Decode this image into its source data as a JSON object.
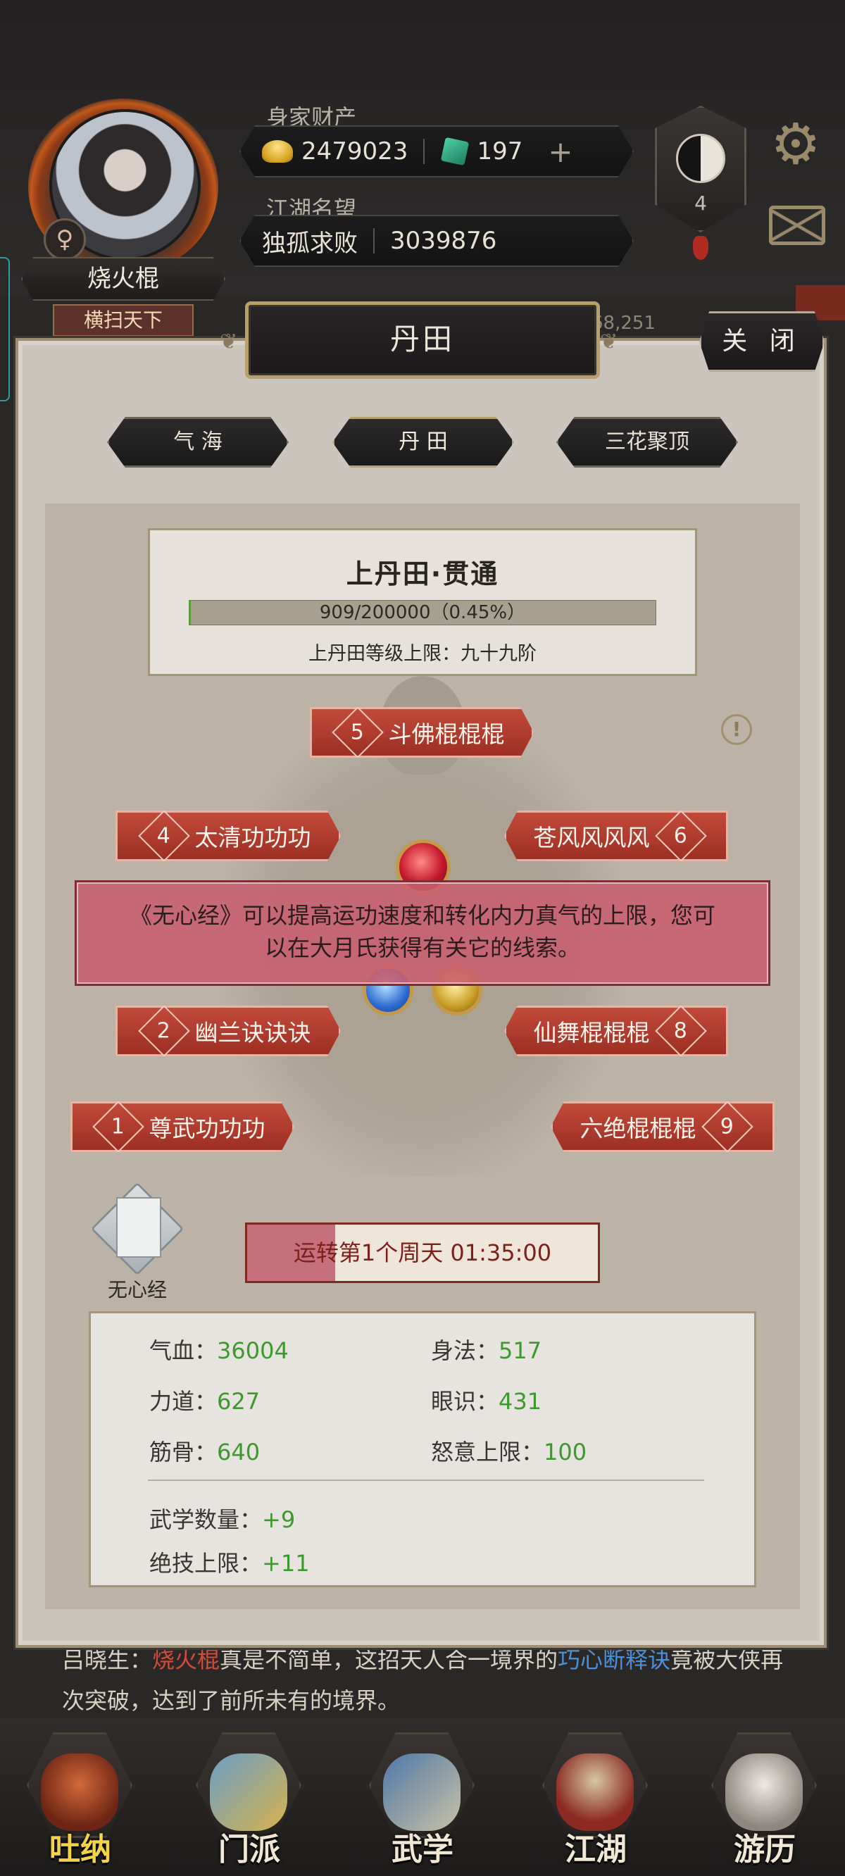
{
  "hud": {
    "player_name": "烧火棍",
    "player_title": "横扫天下",
    "gender_symbol": "♀",
    "wealth_label": "身家财产",
    "gold": "2479023",
    "jade": "197",
    "plus_symbol": "+",
    "reputation_label": "江湖名望",
    "reputation_rank": "独孤求败",
    "reputation_value": "3039876",
    "taiji_level": "4",
    "gear_glyph": "⚙",
    "background_counter": "68,251"
  },
  "dialog": {
    "title": "丹田",
    "close_label": "关 闭",
    "tabs": [
      "气 海",
      "丹 田",
      "三花聚顶"
    ],
    "active_tab": "丹 田",
    "status": {
      "title": "上丹田·贯通",
      "progress_text": "909/200000（0.45%）",
      "progress_fraction": 0.0045,
      "cap_text": "上丹田等级上限：九十九阶"
    },
    "alert_glyph": "!",
    "skills": [
      {
        "num": "5",
        "name": "斗佛棍棍棍"
      },
      {
        "num": "4",
        "name": "太清功功功"
      },
      {
        "num": "6",
        "name": "苍风风风风"
      },
      {
        "num": "2",
        "name": "幽兰诀诀诀"
      },
      {
        "num": "8",
        "name": "仙舞棍棍棍"
      },
      {
        "num": "1",
        "name": "尊武功功功"
      },
      {
        "num": "9",
        "name": "六绝棍棍棍"
      }
    ],
    "tooltip": "《无心经》可以提高运功速度和转化内力真气的上限，您可以在大月氏获得有关它的线索。",
    "book_label": "无心经",
    "cycle": {
      "text": "运转第1个周天 01:35:00",
      "progress_fraction": 0.25
    },
    "stats": {
      "qixue_label": "气血：",
      "qixue": "36004",
      "shenfa_label": "身法：",
      "shenfa": "517",
      "lidao_label": "力道：",
      "lidao": "627",
      "yanshi_label": "眼识：",
      "yanshi": "431",
      "jingu_label": "筋骨：",
      "jingu": "640",
      "nuyi_label": "怒意上限：",
      "nuyi": "100",
      "wuxue_label": "武学数量：",
      "wuxue": "+9",
      "jueji_label": "绝技上限：",
      "jueji": "+11"
    }
  },
  "background_story": {
    "speaker": "吕晓生：",
    "name_highlight": "烧火棍",
    "text1": "真是不简单，这招天人合一境界的",
    "skill_highlight": "巧心断释诀",
    "text2": "竟被大侠再次突破，达到了前所未有的境界。"
  },
  "bottom_nav": [
    "吐纳",
    "门派",
    "武学",
    "江湖",
    "游历"
  ],
  "colors": {
    "skill_red": "#b13d2f",
    "stat_green": "#3c9a2c",
    "tooltip_pink": "#c85f6e",
    "nav_active": "#f3d34a"
  }
}
